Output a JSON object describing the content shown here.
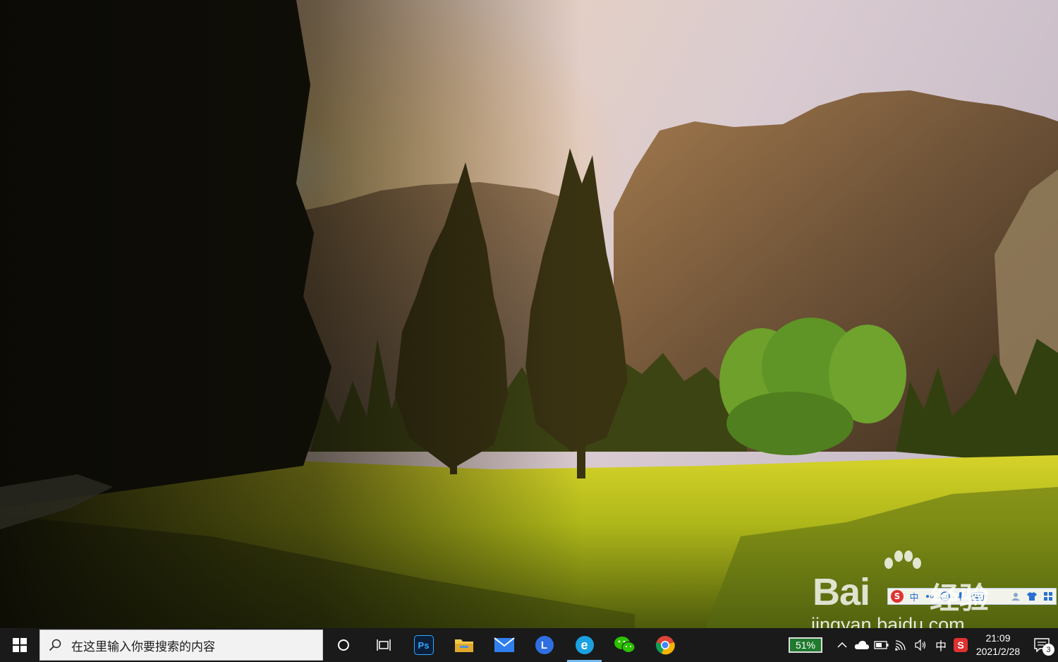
{
  "taskbar": {
    "search_placeholder": "在这里输入你要搜索的内容",
    "apps": [
      {
        "name": "photoshop",
        "label": "Ps",
        "color": "#0b1e3a",
        "text_color": "#31a8ff"
      },
      {
        "name": "file-explorer",
        "color": "#f2c94c"
      },
      {
        "name": "mail",
        "color": "#2f80ed"
      },
      {
        "name": "lark",
        "label": "L",
        "color": "#2f6fe0"
      },
      {
        "name": "edge",
        "label": "e",
        "color": "#1ba1e2"
      },
      {
        "name": "wechat",
        "color": "#2dc100"
      },
      {
        "name": "chrome",
        "color": "#db4437"
      }
    ]
  },
  "tray": {
    "battery_percent": "51%",
    "ime_mode": "中",
    "sogou_label": "S",
    "time": "21:09",
    "date": "2021/2/28",
    "notification_count": "3"
  },
  "ime_toolbar": {
    "logo": "S",
    "mode": "中"
  },
  "watermark": {
    "brand": "Bai",
    "suffix": "经验",
    "url": "jingyan.baidu.com"
  },
  "colors": {
    "taskbar_bg": "#1a1a1a",
    "accent": "#76b9ed"
  }
}
